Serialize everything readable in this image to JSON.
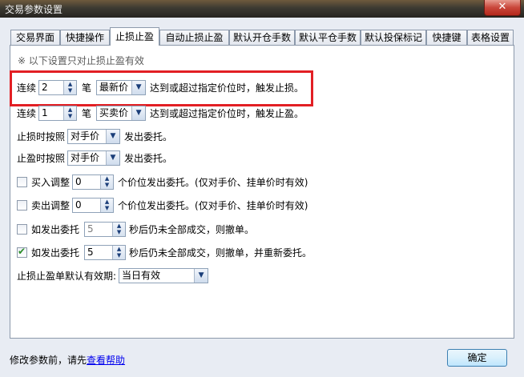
{
  "window": {
    "title": "交易参数设置",
    "close_label": "✕"
  },
  "tabs": [
    {
      "label": "交易界面"
    },
    {
      "label": "快捷操作"
    },
    {
      "label": "止损止盈"
    },
    {
      "label": "自动止损止盈"
    },
    {
      "label": "默认开仓手数"
    },
    {
      "label": "默认平仓手数"
    },
    {
      "label": "默认投保标记"
    },
    {
      "label": "快捷键"
    },
    {
      "label": "表格设置"
    }
  ],
  "note": "※ 以下设置只对止损止盈有效",
  "stop_loss": {
    "prefix": "连续",
    "count": "2",
    "unit": "笔",
    "price_type": "最新价",
    "suffix": "达到或超过指定价位时，触发止损。"
  },
  "take_profit": {
    "prefix": "连续",
    "count": "1",
    "unit": "笔",
    "price_type": "买卖价",
    "suffix": "达到或超过指定价位时，触发止盈。"
  },
  "stop_loss_order": {
    "label": "止损时按照",
    "price": "对手价",
    "suffix": "发出委托。"
  },
  "take_profit_order": {
    "label": "止盈时按照",
    "price": "对手价",
    "suffix": "发出委托。"
  },
  "buy_adjust": {
    "label": "买入调整",
    "value": "0",
    "suffix": "个价位发出委托。(仅对手价、挂单价时有效)",
    "checked": false
  },
  "sell_adjust": {
    "label": "卖出调整",
    "value": "0",
    "suffix": "个价位发出委托。(仅对手价、挂单价时有效)",
    "checked": false
  },
  "cancel_order": {
    "label": "如发出委托",
    "value": "5",
    "suffix": "秒后仍未全部成交，则撤单。",
    "checked": false
  },
  "cancel_reorder": {
    "label": "如发出委托",
    "value": "5",
    "suffix": "秒后仍未全部成交，则撤单，并重新委托。",
    "checked": true
  },
  "validity": {
    "label": "止损止盈单默认有效期:",
    "value": "当日有效"
  },
  "footer": {
    "text": "修改参数前，请先",
    "link": "查看帮助",
    "ok_label": "确定"
  },
  "icons": {
    "spin": "spin-arrows-icon",
    "dropdown": "chevron-down-icon",
    "check": "checkmark-icon"
  },
  "colors": {
    "highlight": "#e21f24",
    "link": "#0000ee"
  }
}
